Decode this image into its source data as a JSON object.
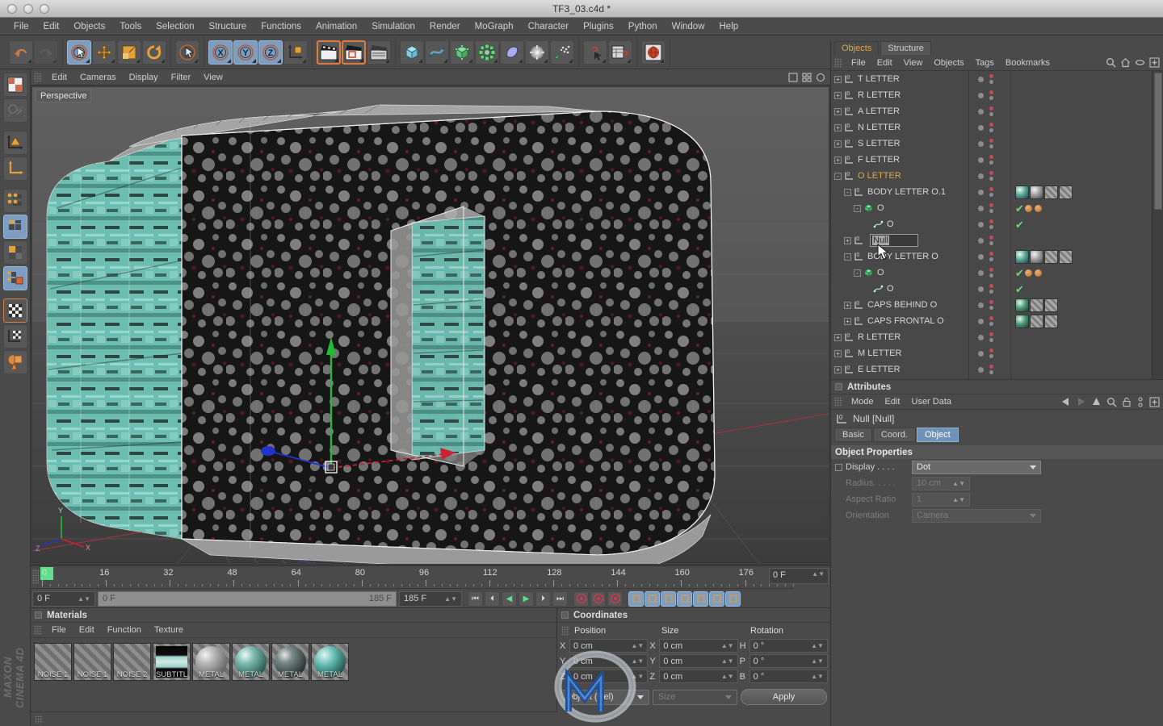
{
  "window": {
    "title": "TF3_03.c4d *",
    "brand": "MAXON CINEMA 4D"
  },
  "menubar": {
    "items": [
      "File",
      "Edit",
      "Objects",
      "Tools",
      "Selection",
      "Structure",
      "Functions",
      "Animation",
      "Simulation",
      "Render",
      "MoGraph",
      "Character",
      "Plugins",
      "Python",
      "Window",
      "Help"
    ]
  },
  "toolbar": {
    "groups": [
      {
        "name": "history",
        "buttons": [
          {
            "name": "undo-icon",
            "state": "normal"
          },
          {
            "name": "redo-icon",
            "state": "disabled"
          }
        ]
      },
      {
        "name": "transform",
        "buttons": [
          {
            "name": "select-tool-icon",
            "state": "active"
          },
          {
            "name": "move-tool-icon",
            "state": "normal"
          },
          {
            "name": "scale-tool-icon",
            "state": "normal"
          },
          {
            "name": "rotate-tool-icon",
            "state": "normal"
          }
        ]
      },
      {
        "name": "live-select",
        "buttons": [
          {
            "name": "live-selection-icon",
            "state": "normal"
          }
        ]
      },
      {
        "name": "axis-locks",
        "buttons": [
          {
            "name": "x-axis-lock-icon",
            "state": "active"
          },
          {
            "name": "y-axis-lock-icon",
            "state": "active"
          },
          {
            "name": "z-axis-lock-icon",
            "state": "active"
          },
          {
            "name": "world-coordinate-icon",
            "state": "normal"
          }
        ]
      },
      {
        "name": "render",
        "buttons": [
          {
            "name": "render-view-icon",
            "state": "highlight"
          },
          {
            "name": "render-region-icon",
            "state": "highlight"
          },
          {
            "name": "render-settings-icon",
            "state": "normal"
          }
        ]
      },
      {
        "name": "create",
        "buttons": [
          {
            "name": "cube-primitive-icon",
            "state": "normal"
          },
          {
            "name": "spline-icon",
            "state": "normal"
          },
          {
            "name": "nurbs-icon",
            "state": "normal"
          },
          {
            "name": "array-icon",
            "state": "normal"
          },
          {
            "name": "deformer-icon",
            "state": "normal"
          },
          {
            "name": "light-icon",
            "state": "normal"
          },
          {
            "name": "particles-icon",
            "state": "normal"
          }
        ]
      },
      {
        "name": "help",
        "buttons": [
          {
            "name": "help-cursor-icon",
            "state": "normal"
          },
          {
            "name": "content-browser-icon",
            "state": "normal"
          }
        ]
      },
      {
        "name": "web",
        "buttons": [
          {
            "name": "globe-icon",
            "state": "normal"
          }
        ]
      }
    ]
  },
  "lefttools": {
    "buttons": [
      {
        "name": "layout-icon",
        "state": "normal"
      },
      {
        "name": "render-preview-icon",
        "state": "normal"
      },
      {
        "name": "make-editable-icon",
        "state": "normal"
      },
      {
        "name": "object-axis-icon",
        "state": "normal"
      },
      {
        "name": "points-mode-icon",
        "state": "normal"
      },
      {
        "name": "edges-mode-icon",
        "state": "active"
      },
      {
        "name": "polygons-mode-icon",
        "state": "normal"
      },
      {
        "name": "model-mode-icon",
        "state": "active"
      },
      {
        "name": "texture-mode-icon",
        "state": "highlight"
      },
      {
        "name": "texture-axis-icon",
        "state": "normal"
      },
      {
        "name": "workplane-icon",
        "state": "normal"
      }
    ]
  },
  "viewport": {
    "menu": [
      "Edit",
      "Cameras",
      "Display",
      "Filter",
      "View"
    ],
    "label": "Perspective",
    "axis_colors": {
      "x": "#cc2233",
      "y": "#22bb33",
      "z": "#2233cc"
    },
    "object_colors": {
      "side_teal": "#7fc5bb",
      "front_gray": "#8d8d8d",
      "front_dark": "#151515"
    }
  },
  "timeline": {
    "ticks": [
      "0",
      "16",
      "32",
      "48",
      "64",
      "80",
      "96",
      "112",
      "128",
      "144",
      "160",
      "176"
    ],
    "current_frame_field": "0 F",
    "start_field": "0 F",
    "preview_start": "0 F",
    "preview_end": "185 F",
    "end_field": "185 F",
    "transport": [
      {
        "name": "go-to-start-button",
        "glyph": "⏮"
      },
      {
        "name": "step-back-button",
        "glyph": "⏴"
      },
      {
        "name": "play-backwards-button",
        "glyph": "◀"
      },
      {
        "name": "play-forward-button",
        "glyph": "▶"
      },
      {
        "name": "step-forward-button",
        "glyph": "⏵"
      },
      {
        "name": "go-to-end-button",
        "glyph": "⏭"
      }
    ],
    "record_buttons": [
      {
        "name": "record-keyframe-button"
      },
      {
        "name": "autokeying-button"
      },
      {
        "name": "keyframe-selection-button"
      }
    ],
    "key_toggles": [
      {
        "name": "position-key-toggle",
        "state": "active"
      },
      {
        "name": "scale-key-toggle",
        "state": "active"
      },
      {
        "name": "rotation-key-toggle",
        "state": "active"
      },
      {
        "name": "parameter-key-toggle",
        "state": "active"
      },
      {
        "name": "point-level-anim-toggle",
        "state": "active"
      },
      {
        "name": "autokey-toggle",
        "state": "active"
      },
      {
        "name": "keyframe-mode-toggle",
        "state": "active"
      }
    ]
  },
  "materials": {
    "title": "Materials",
    "menu": [
      "File",
      "Edit",
      "Function",
      "Texture"
    ],
    "items": [
      {
        "name": "NOISE 1",
        "preview": "hatch"
      },
      {
        "name": "NOISE 1",
        "preview": "hatch"
      },
      {
        "name": "NOISE 2",
        "preview": "hatch"
      },
      {
        "name": "SUBTITL",
        "preview": "gradient"
      },
      {
        "name": "METAL",
        "preview": "sphere-gray"
      },
      {
        "name": "METAL",
        "preview": "sphere-teal"
      },
      {
        "name": "METAL",
        "preview": "sphere-dark"
      },
      {
        "name": "METAL",
        "preview": "sphere-cyan"
      }
    ]
  },
  "coordinates": {
    "title": "Coordinates",
    "columns": [
      "Position",
      "Size",
      "Rotation"
    ],
    "position": [
      {
        "axis": "X",
        "value": "0 cm"
      },
      {
        "axis": "Y",
        "value": "0 cm"
      },
      {
        "axis": "Z",
        "value": "0 cm"
      }
    ],
    "size": [
      {
        "axis": "X",
        "value": "0 cm"
      },
      {
        "axis": "Y",
        "value": "0 cm"
      },
      {
        "axis": "Z",
        "value": "0 cm"
      }
    ],
    "rotation": [
      {
        "axis": "H",
        "value": "0 °"
      },
      {
        "axis": "P",
        "value": "0 °"
      },
      {
        "axis": "B",
        "value": "0 °"
      }
    ],
    "mode_select": "Object (Rel)",
    "size_select": "Size",
    "apply_label": "Apply"
  },
  "object_manager": {
    "tabs": [
      {
        "label": "Objects",
        "active": true
      },
      {
        "label": "Structure",
        "active": false
      }
    ],
    "menu": [
      "File",
      "Edit",
      "View",
      "Objects",
      "Tags",
      "Bookmarks"
    ],
    "icons": [
      "search-icon",
      "home-icon",
      "lasso-icon",
      "add-panel-icon"
    ],
    "rename_value": "Null",
    "rows": [
      {
        "label": "T LETTER",
        "depth": 0,
        "icon": "null-object",
        "selected": false,
        "expand": "+",
        "vis": true,
        "tags": []
      },
      {
        "label": "R LETTER",
        "depth": 0,
        "icon": "null-object",
        "selected": false,
        "expand": "+",
        "vis": true,
        "tags": []
      },
      {
        "label": "A LETTER",
        "depth": 0,
        "icon": "null-object",
        "selected": false,
        "expand": "+",
        "vis": true,
        "tags": []
      },
      {
        "label": "N LETTER",
        "depth": 0,
        "icon": "null-object",
        "selected": false,
        "expand": "+",
        "vis": true,
        "tags": []
      },
      {
        "label": "S LETTER",
        "depth": 0,
        "icon": "null-object",
        "selected": false,
        "expand": "+",
        "vis": true,
        "tags": []
      },
      {
        "label": "F LETTER",
        "depth": 0,
        "icon": "null-object",
        "selected": false,
        "expand": "+",
        "vis": true,
        "tags": []
      },
      {
        "label": "O LETTER",
        "depth": 0,
        "icon": "null-object",
        "selected": true,
        "expand": "-",
        "vis": true,
        "tags": []
      },
      {
        "label": "BODY LETTER O.1",
        "depth": 1,
        "icon": "null-object",
        "selected": false,
        "expand": "-",
        "vis": true,
        "tags": [
          "mat-teal",
          "mat-gray",
          "hatch",
          "hatch"
        ]
      },
      {
        "label": "O",
        "depth": 2,
        "icon": "extrude",
        "selected": false,
        "expand": "-",
        "vis": true,
        "tags": [
          "check",
          "dot-orange",
          "dot-orange"
        ]
      },
      {
        "label": "O",
        "depth": 3,
        "icon": "spline",
        "selected": false,
        "expand": "",
        "vis": true,
        "tags": [
          "check"
        ]
      },
      {
        "label": "",
        "depth": 1,
        "icon": "null-object",
        "selected": false,
        "expand": "+",
        "vis": true,
        "tags": [],
        "renaming": true
      },
      {
        "label": "BODY LETTER O",
        "depth": 1,
        "icon": "null-object",
        "selected": false,
        "expand": "-",
        "vis": true,
        "tags": [
          "mat-teal",
          "mat-gray",
          "hatch",
          "hatch"
        ]
      },
      {
        "label": "O",
        "depth": 2,
        "icon": "extrude",
        "selected": false,
        "expand": "-",
        "vis": true,
        "tags": [
          "check",
          "dot-orange",
          "dot-orange"
        ]
      },
      {
        "label": "O",
        "depth": 3,
        "icon": "spline",
        "selected": false,
        "expand": "",
        "vis": true,
        "tags": [
          "check"
        ]
      },
      {
        "label": "CAPS BEHIND O",
        "depth": 1,
        "icon": "null-object",
        "selected": false,
        "expand": "+",
        "vis": true,
        "tags": [
          "mat-green",
          "hatch",
          "hatch"
        ]
      },
      {
        "label": "CAPS FRONTAL O",
        "depth": 1,
        "icon": "null-object",
        "selected": false,
        "expand": "+",
        "vis": true,
        "tags": [
          "mat-green",
          "hatch",
          "hatch"
        ]
      },
      {
        "label": "R LETTER",
        "depth": 0,
        "icon": "null-object",
        "selected": false,
        "expand": "+",
        "vis": true,
        "tags": []
      },
      {
        "label": "M LETTER",
        "depth": 0,
        "icon": "null-object",
        "selected": false,
        "expand": "+",
        "vis": true,
        "tags": []
      },
      {
        "label": "E LETTER",
        "depth": 0,
        "icon": "null-object",
        "selected": false,
        "expand": "+",
        "vis": true,
        "tags": []
      }
    ]
  },
  "attributes": {
    "title": "Attributes",
    "menu": [
      "Mode",
      "Edit",
      "User Data"
    ],
    "icons": [
      "back-arrow-icon",
      "forward-arrow-icon",
      "up-arrow-icon",
      "search-icon",
      "lock-icon",
      "link-icon",
      "add-panel-icon"
    ],
    "object_label": "Null [Null]",
    "tabs": [
      {
        "label": "Basic",
        "active": false
      },
      {
        "label": "Coord.",
        "active": false
      },
      {
        "label": "Object",
        "active": true
      }
    ],
    "section_title": "Object Properties",
    "properties": [
      {
        "label": "Display . . . .",
        "value": "Dot",
        "type": "select",
        "enabled": true,
        "checkbox": true
      },
      {
        "label": "Radius. . . . .",
        "value": "10 cm",
        "type": "number",
        "enabled": false,
        "checkbox": false
      },
      {
        "label": "Aspect Ratio",
        "value": "1",
        "type": "number",
        "enabled": false,
        "checkbox": false
      },
      {
        "label": "Orientation",
        "value": "Camera",
        "type": "select",
        "enabled": false,
        "checkbox": false
      }
    ]
  },
  "colors": {
    "panel_bg": "#4a4a4a",
    "accent_blue": "#7d9ec0",
    "accent_orange": "#e0a83e",
    "highlight_orange": "#e07a3e",
    "text": "#cfcfcf"
  }
}
